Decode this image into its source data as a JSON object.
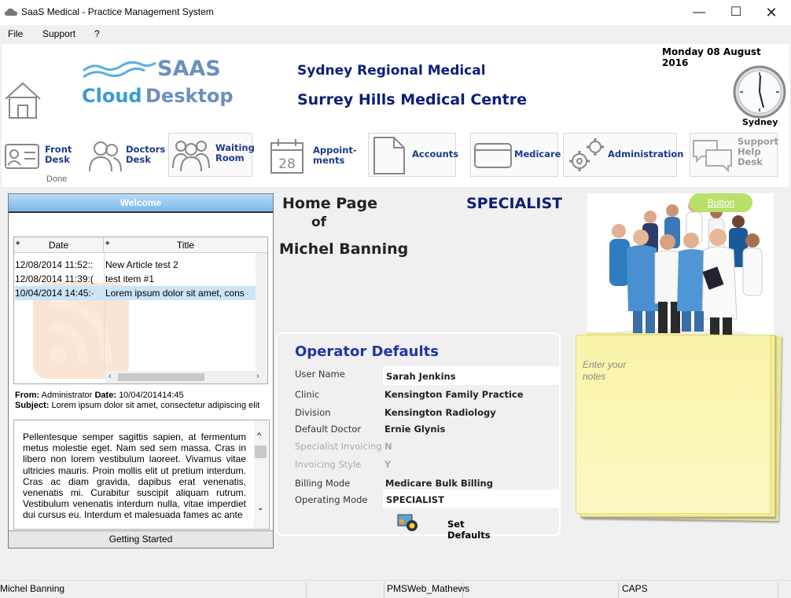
{
  "window": {
    "title": "SaaS Medical - Practice Management System"
  },
  "menu": {
    "file": "File",
    "support": "Support",
    "help": "?"
  },
  "header": {
    "date": "Monday 08 August 2016",
    "org_name": "Sydney Regional Medical",
    "practice_name": "Surrey Hills Medical Centre",
    "logo_line1": "SAAS",
    "logo_cloud": "Cloud",
    "logo_desktop": "Desktop",
    "clock_city": "Sydney"
  },
  "nav": {
    "front_desk": [
      "Front",
      "Desk"
    ],
    "front_desk_status": "Done",
    "doctors_desk": [
      "Doctors",
      "Desk"
    ],
    "waiting_room": [
      "Waiting",
      "Room"
    ],
    "appointments": [
      "Appoint-",
      "ments"
    ],
    "calendar_day": "28",
    "accounts": "Accounts",
    "medicare": "Medicare",
    "administration": "Administration",
    "support": [
      "Support",
      "Help",
      "Desk"
    ]
  },
  "welcome": {
    "title": "Welcome",
    "columns": [
      "Date",
      "Title"
    ],
    "rows": [
      {
        "date": "12/08/2014 11:52::",
        "title": "New Article test 2"
      },
      {
        "date": "12/08/2014 11:39:(",
        "title": "test item #1"
      },
      {
        "date": "10/04/2014 14:45:·",
        "title": "Lorem ipsum dolor sit amet, cons"
      }
    ],
    "from_label": "From:",
    "from_value": "Administrator",
    "date_label": "Date:",
    "date_value": "10/04/201414:45",
    "subject_label": "Subject:",
    "subject_value": "Lorem ipsum dolor sit amet, consectetur adipiscing elit",
    "body": "Pellentesque semper sagittis sapien, at fermentum metus molestie eget. Nam sed sem massa. Cras in libero non lorem vestibulum laoreet. Vivamus vitae ultricies mauris. Proin mollis elit ut pretium interdum. Cras ac diam gravida, dapibus erat venenatis, venenatis mi. Curabitur suscipit aliquam rutrum. Vestibulum venenatis interdum nulla, vitae imperdiet dui cursus eu. Interdum et malesuada fames ac ante",
    "footer": "Getting Started"
  },
  "home": {
    "line1": "Home Page",
    "line2": "of",
    "user": "Michel Banning",
    "mode": "SPECIALIST"
  },
  "operator_defaults": {
    "title": "Operator Defaults",
    "fields": [
      {
        "label": "User Name",
        "value": "Sarah Jenkins"
      },
      {
        "label": "Clinic",
        "value": "Kensington Family Practice"
      },
      {
        "label": "Division",
        "value": "Kensington Radiology"
      },
      {
        "label": "Default Doctor",
        "value": "Ernie Glynis"
      },
      {
        "label": "Specialist Invoicing",
        "value": "N"
      },
      {
        "label": "Invoicing Style",
        "value": "Y"
      },
      {
        "label": "Billing Mode",
        "value": "Medicare Bulk Billing"
      },
      {
        "label": "Operating Mode",
        "value": "SPECIALIST"
      }
    ],
    "set_defaults": "Set Defaults"
  },
  "side": {
    "button": "Button",
    "notes_placeholder": "Enter your notes"
  },
  "status": {
    "user": "Michel Banning",
    "server": "PMSWeb_Mathews",
    "caps": "CAPS"
  }
}
